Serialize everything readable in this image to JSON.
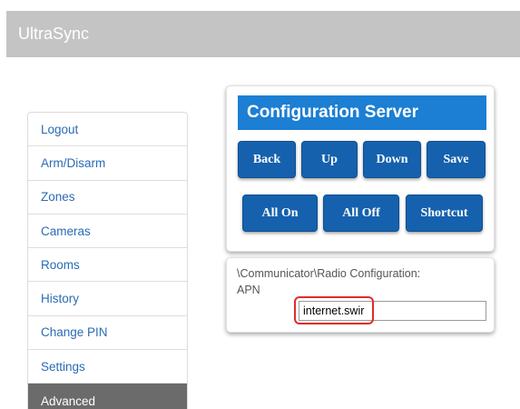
{
  "header": {
    "title": "UltraSync",
    "background": "#c4c4c4"
  },
  "sidebar": {
    "items": [
      {
        "label": "Logout",
        "active": false
      },
      {
        "label": "Arm/Disarm",
        "active": false
      },
      {
        "label": "Zones",
        "active": false
      },
      {
        "label": "Cameras",
        "active": false
      },
      {
        "label": "Rooms",
        "active": false
      },
      {
        "label": "History",
        "active": false
      },
      {
        "label": "Change PIN",
        "active": false
      },
      {
        "label": "Settings",
        "active": false
      },
      {
        "label": "Advanced",
        "active": true
      }
    ]
  },
  "config": {
    "title": "Configuration Server",
    "buttons": {
      "back": "Back",
      "up": "Up",
      "down": "Down",
      "save": "Save",
      "all_on": "All On",
      "all_off": "All Off",
      "shortcut": "Shortcut"
    },
    "accent": "#1c7fd3",
    "button_color": "#1561ae"
  },
  "path_panel": {
    "path": "\\Communicator\\Radio Configuration:",
    "field_label": "APN",
    "field_value": "internet.swir",
    "highlight_color": "#e12b2b"
  }
}
